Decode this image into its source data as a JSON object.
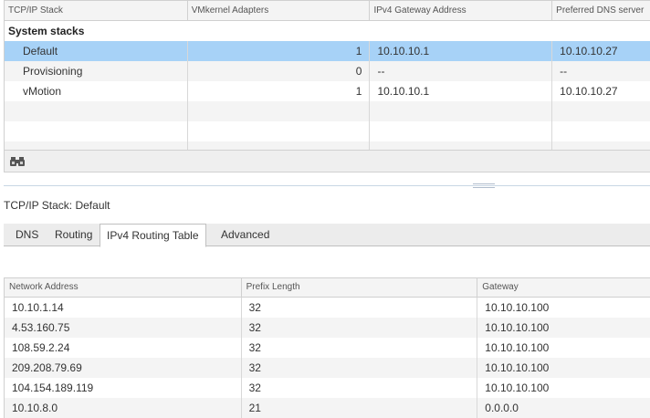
{
  "stacks_grid": {
    "columns": [
      "TCP/IP Stack",
      "VMkernel Adapters",
      "IPv4 Gateway Address",
      "Preferred DNS server"
    ],
    "group_label": "System stacks",
    "rows": [
      {
        "name": "Default",
        "adapters": "1",
        "gateway": "10.10.10.1",
        "dns": "10.10.10.27",
        "selected": true
      },
      {
        "name": "Provisioning",
        "adapters": "0",
        "gateway": "--",
        "dns": "--",
        "selected": false
      },
      {
        "name": "vMotion",
        "adapters": "1",
        "gateway": "10.10.10.1",
        "dns": "10.10.10.27",
        "selected": false
      }
    ],
    "footer_icon": "binoculars-icon"
  },
  "detail": {
    "title": "TCP/IP Stack: Default",
    "tabs": [
      {
        "label": "DNS",
        "active": false
      },
      {
        "label": "Routing",
        "active": false
      },
      {
        "label": "IPv4 Routing Table",
        "active": true
      },
      {
        "label": "Advanced",
        "active": false
      }
    ]
  },
  "routing_table": {
    "columns": [
      "Network Address",
      "Prefix Length",
      "Gateway"
    ],
    "rows": [
      {
        "network": "10.10.1.14",
        "prefix": "32",
        "gateway": "10.10.10.100"
      },
      {
        "network": "4.53.160.75",
        "prefix": "32",
        "gateway": "10.10.10.100"
      },
      {
        "network": "108.59.2.24",
        "prefix": "32",
        "gateway": "10.10.10.100"
      },
      {
        "network": "209.208.79.69",
        "prefix": "32",
        "gateway": "10.10.10.100"
      },
      {
        "network": "104.154.189.119",
        "prefix": "32",
        "gateway": "10.10.10.100"
      },
      {
        "network": "10.10.8.0",
        "prefix": "21",
        "gateway": "0.0.0.0"
      }
    ]
  },
  "colors": {
    "selected_row": "#a7d2f7",
    "alt_row": "#f4f4f4",
    "header_bg": "#f4f4f4"
  }
}
